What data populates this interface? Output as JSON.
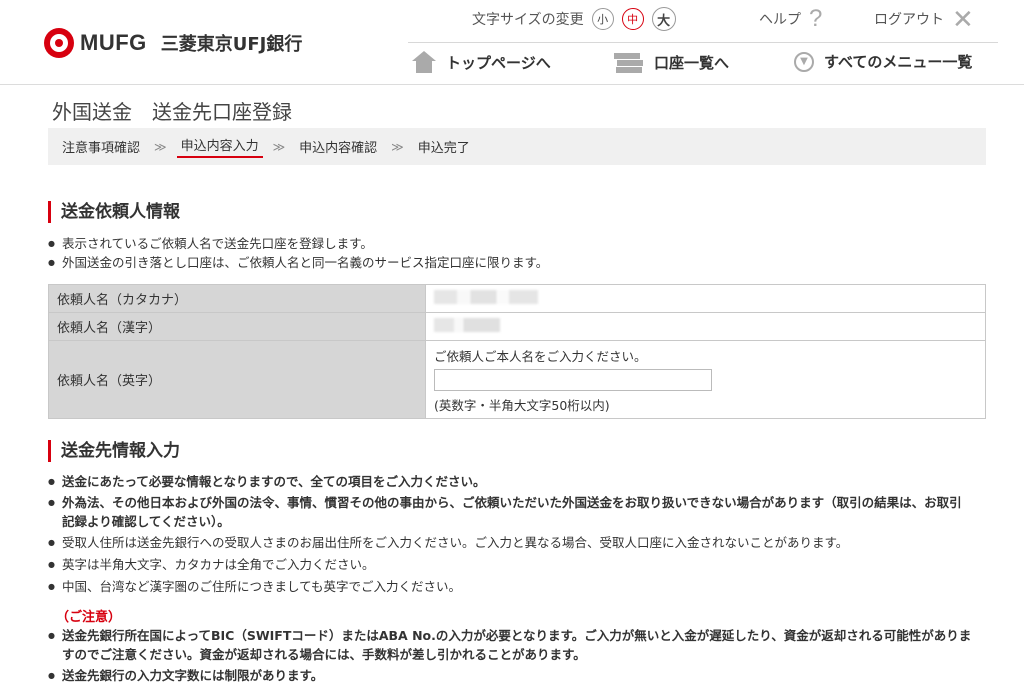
{
  "header": {
    "brand": "MUFG",
    "bank_name": "三菱東京UFJ銀行",
    "font_size_label": "文字サイズの変更",
    "font_sizes": [
      "小",
      "中",
      "大"
    ],
    "help_label": "ヘルプ",
    "logout_label": "ログアウト",
    "nav": {
      "top": "トップページへ",
      "accounts": "口座一覧へ",
      "menu": "すべてのメニュー一覧"
    }
  },
  "page": {
    "title": "外国送金　送金先口座登録",
    "steps": [
      "注意事項確認",
      "申込内容入力",
      "申込内容確認",
      "申込完了"
    ],
    "current_step": "申込内容入力"
  },
  "sender_section": {
    "heading": "送金依頼人情報",
    "bullets": [
      "表示されているご依頼人名で送金先口座を登録します。",
      "外国送金の引き落とし口座は、ご依頼人名と同一名義のサービス指定口座に限ります。"
    ],
    "rows": {
      "kana_label": "依頼人名（カタカナ）",
      "kanji_label": "依頼人名（漢字）",
      "english_label": "依頼人名（英字）",
      "english_prompt": "ご依頼人ご本人名をご入力ください。",
      "english_value": "",
      "english_note": "(英数字・半角大文字50桁以内)"
    }
  },
  "recipient_section": {
    "heading": "送金先情報入力",
    "bold_bullets": [
      "送金にあたって必要な情報となりますので、全ての項目をご入力ください。",
      "外為法、その他日本および外国の法令、事情、慣習その他の事由から、ご依頼いただいた外国送金をお取り扱いできない場合があります（取引の結果は、お取引記録より確認してください）。"
    ],
    "bullets": [
      "受取人住所は送金先銀行への受取人さまのお届出住所をご入力ください。ご入力と異なる場合、受取人口座に入金されないことがあります。",
      "英字は半角大文字、カタカナは全角でご入力ください。",
      "中国、台湾など漢字圏のご住所につきましても英字でご入力ください。"
    ],
    "caution_label": "（ご注意）",
    "caution_bullets": [
      "送金先銀行所在国によってBIC（SWIFTコード）またはABA No.の入力が必要となります。ご入力が無いと入金が遅延したり、資金が返却される可能性がありますのでご注意ください。資金が返却される場合には、手数料が差し引かれることがあります。",
      "送金先銀行の入力文字数には制限があります。"
    ]
  }
}
